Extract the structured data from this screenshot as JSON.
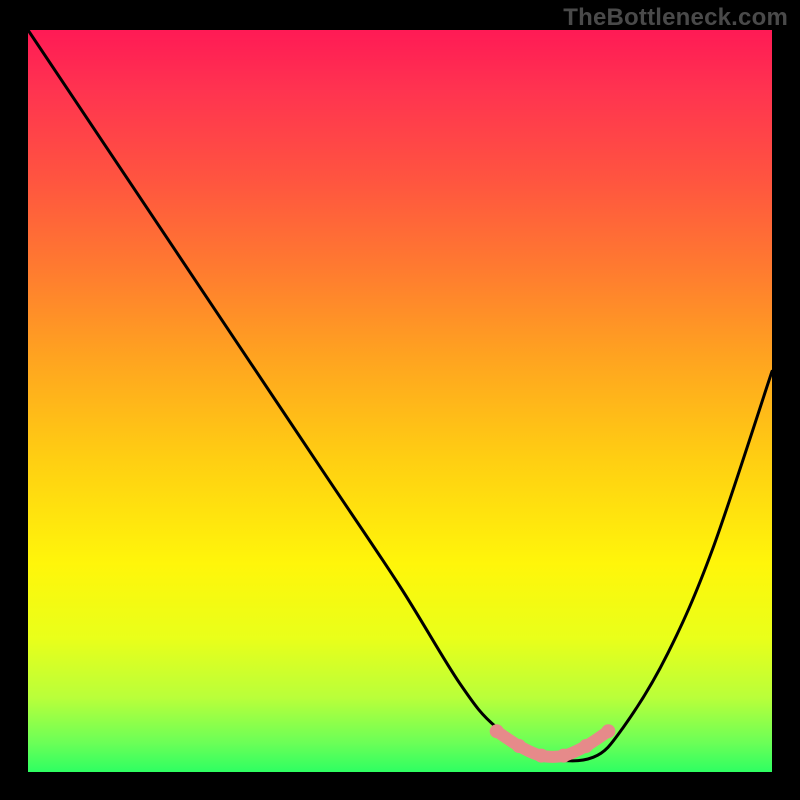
{
  "watermark": "TheBottleneck.com",
  "chart_data": {
    "type": "line",
    "title": "",
    "xlabel": "",
    "ylabel": "",
    "xlim": [
      0,
      100
    ],
    "ylim": [
      0,
      100
    ],
    "series": [
      {
        "name": "bottleneck-curve",
        "x": [
          0,
          10,
          20,
          30,
          40,
          50,
          58,
          63,
          70,
          76,
          80,
          86,
          92,
          100
        ],
        "values": [
          100,
          85,
          70,
          55,
          40,
          25,
          12,
          6,
          2,
          2,
          6,
          16,
          30,
          54
        ]
      }
    ],
    "highlight": {
      "name": "optimal-range",
      "color": "#e68a8a",
      "x": [
        63,
        66,
        69,
        72,
        75,
        78
      ],
      "values": [
        5.5,
        3.5,
        2.2,
        2.2,
        3.5,
        5.5
      ]
    },
    "gradient_stops": [
      {
        "pos": 0,
        "color": "#ff1a55"
      },
      {
        "pos": 20,
        "color": "#ff5440"
      },
      {
        "pos": 44,
        "color": "#ffa320"
      },
      {
        "pos": 72,
        "color": "#fff60a"
      },
      {
        "pos": 90,
        "color": "#b9ff3a"
      },
      {
        "pos": 100,
        "color": "#2eff62"
      }
    ]
  }
}
